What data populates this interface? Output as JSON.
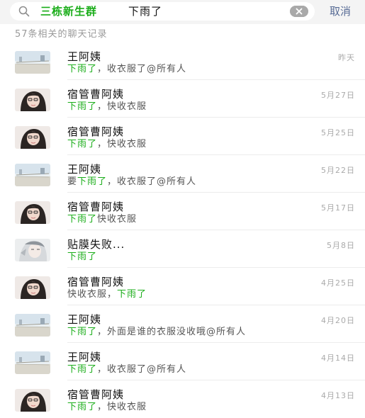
{
  "search": {
    "group_name": "三栋新生群",
    "query": "下雨了",
    "cancel_label": "取消"
  },
  "result_count": "57条相关的聊天记录",
  "colors": {
    "highlight": "#1aad19",
    "link": "#576b95"
  },
  "results": [
    {
      "name": "王阿姨",
      "date": "昨天",
      "avatar": "wang",
      "snippet": [
        {
          "t": "下雨了",
          "hl": true
        },
        {
          "t": "，收衣服了@所有人",
          "hl": false
        }
      ]
    },
    {
      "name": "宿管曹阿姨",
      "date": "5月27日",
      "avatar": "cao",
      "snippet": [
        {
          "t": "下雨了",
          "hl": true
        },
        {
          "t": "，快收衣服",
          "hl": false
        }
      ]
    },
    {
      "name": "宿管曹阿姨",
      "date": "5月25日",
      "avatar": "cao",
      "snippet": [
        {
          "t": "下雨了",
          "hl": true
        },
        {
          "t": "，快收衣服",
          "hl": false
        }
      ]
    },
    {
      "name": "王阿姨",
      "date": "5月22日",
      "avatar": "wang",
      "snippet": [
        {
          "t": "要",
          "hl": false
        },
        {
          "t": "下雨了",
          "hl": true
        },
        {
          "t": "，收衣服了@所有人",
          "hl": false
        }
      ]
    },
    {
      "name": "宿管曹阿姨",
      "date": "5月17日",
      "avatar": "cao",
      "snippet": [
        {
          "t": "下雨了",
          "hl": true
        },
        {
          "t": "快收衣服",
          "hl": false
        }
      ]
    },
    {
      "name": "贴膜失败...",
      "date": "5月8日",
      "avatar": "tie",
      "snippet": [
        {
          "t": "下雨了",
          "hl": true
        }
      ]
    },
    {
      "name": "宿管曹阿姨",
      "date": "4月25日",
      "avatar": "cao",
      "snippet": [
        {
          "t": "快收衣服，",
          "hl": false
        },
        {
          "t": "下雨了",
          "hl": true
        }
      ]
    },
    {
      "name": "王阿姨",
      "date": "4月20日",
      "avatar": "wang",
      "snippet": [
        {
          "t": "下雨了",
          "hl": true
        },
        {
          "t": "，外面是谁的衣服没收哦@所有人",
          "hl": false
        }
      ]
    },
    {
      "name": "王阿姨",
      "date": "4月14日",
      "avatar": "wang",
      "snippet": [
        {
          "t": "下雨了",
          "hl": true
        },
        {
          "t": "，收衣服了@所有人",
          "hl": false
        }
      ]
    },
    {
      "name": "宿管曹阿姨",
      "date": "4月13日",
      "avatar": "cao",
      "snippet": [
        {
          "t": "下雨了",
          "hl": true
        },
        {
          "t": "，快收衣服",
          "hl": false
        }
      ]
    }
  ]
}
